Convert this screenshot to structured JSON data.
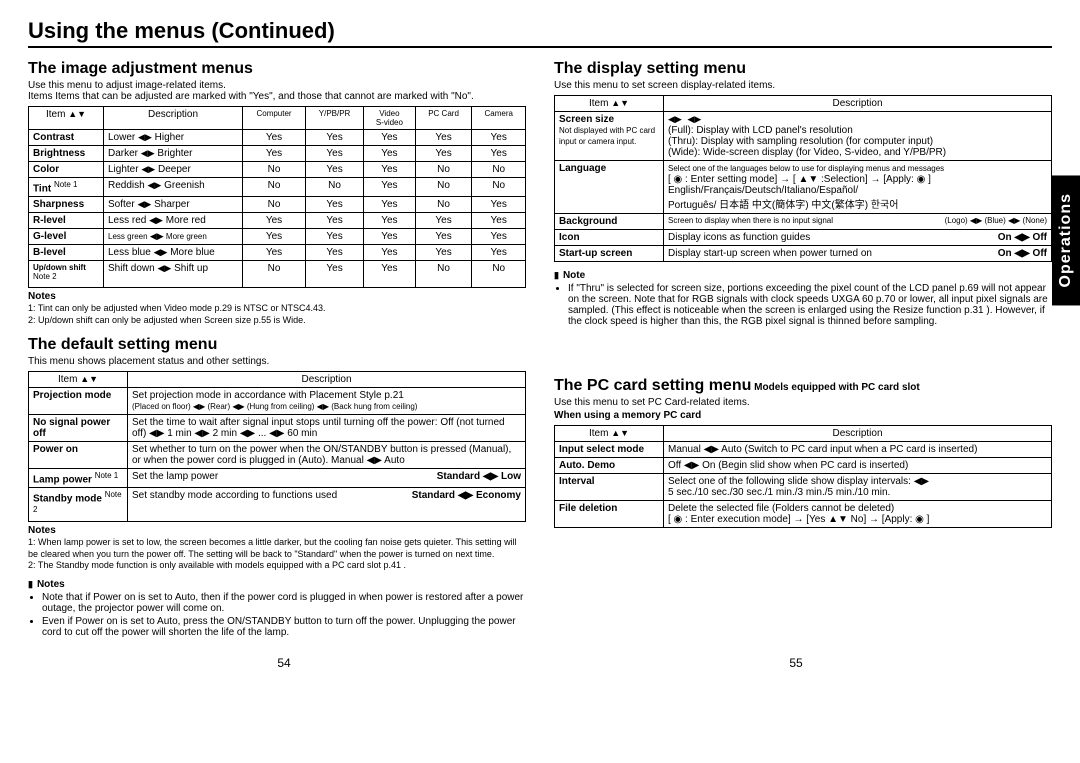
{
  "title": "Using the menus (Continued)",
  "left": {
    "h_image": "The image adjustment menus",
    "image_intro": "Use this menu to adjust image-related items.\nItems Items that can be adjusted are marked with \"Yes\", and those that cannot are marked with \"No\".",
    "image_headers": [
      "Item",
      "Description",
      "Computer",
      "Y/PB/PR",
      "Video\nS-video",
      "PC Card",
      "Camera"
    ],
    "image_rows": [
      {
        "item": "Contrast",
        "lo": "Lower",
        "hi": "Higher",
        "v": [
          "Yes",
          "Yes",
          "Yes",
          "Yes",
          "Yes"
        ]
      },
      {
        "item": "Brightness",
        "lo": "Darker",
        "hi": "Brighter",
        "v": [
          "Yes",
          "Yes",
          "Yes",
          "Yes",
          "Yes"
        ]
      },
      {
        "item": "Color",
        "lo": "Lighter",
        "hi": "Deeper",
        "v": [
          "No",
          "Yes",
          "Yes",
          "No",
          "No"
        ]
      },
      {
        "item": "Tint",
        "note": "Note 1",
        "lo": "Reddish",
        "hi": "Greenish",
        "v": [
          "No",
          "No",
          "Yes",
          "No",
          "No"
        ]
      },
      {
        "item": "Sharpness",
        "lo": "Softer",
        "hi": "Sharper",
        "v": [
          "No",
          "Yes",
          "Yes",
          "No",
          "Yes"
        ]
      },
      {
        "item": "R-level",
        "lo": "Less red",
        "hi": "More red",
        "v": [
          "Yes",
          "Yes",
          "Yes",
          "Yes",
          "Yes"
        ]
      },
      {
        "item": "G-level",
        "lo": "Less green",
        "hi": "More green",
        "v": [
          "Yes",
          "Yes",
          "Yes",
          "Yes",
          "Yes"
        ]
      },
      {
        "item": "B-level",
        "lo": "Less blue",
        "hi": "More blue",
        "v": [
          "Yes",
          "Yes",
          "Yes",
          "Yes",
          "Yes"
        ]
      },
      {
        "item": "Up/down shift",
        "note": "Note 2",
        "lo": "Shift down",
        "hi": "Shift up",
        "v": [
          "No",
          "Yes",
          "Yes",
          "No",
          "No"
        ]
      }
    ],
    "image_notes_title": "Notes",
    "image_note1": "1: Tint can only be adjusted when Video mode p.29  is NTSC or NTSC4.43.",
    "image_note2": "2: Up/down shift can only be adjusted when Screen size p.55  is Wide.",
    "h_default": "The default setting menu",
    "default_intro": "This menu shows placement status and other settings.",
    "default_headers": [
      "Item",
      "Description"
    ],
    "d_proj_item": "Projection mode",
    "d_proj_desc": "Set projection mode in accordance with Placement Style p.21",
    "d_proj_opts": "(Placed on floor) ◀▶  (Rear) ◀▶  (Hung from ceiling) ◀▶  (Back hung from ceiling)",
    "d_nosig_item": "No signal power off",
    "d_nosig_desc": "Set the time to wait after signal input stops until turning off the power: Off (not turned off) ◀▶ 1 min ◀▶ 2 min ◀▶ ... ◀▶ 60 min",
    "d_power_item": "Power on",
    "d_power_desc": "Set whether to turn on the power when the ON/STANDBY button is pressed (Manual), or when the power cord is plugged in (Auto).  Manual ◀▶ Auto",
    "d_lamp_item": "Lamp power",
    "d_lamp_note": "Note 1",
    "d_lamp_desc": "Set the lamp power",
    "d_lamp_right": "Standard ◀▶ Low",
    "d_standby_item": "Standby mode",
    "d_standby_note": "Note 2",
    "d_standby_desc": "Set standby mode according to functions used",
    "d_standby_right": "Standard ◀▶ Economy",
    "default_notes_title": "Notes",
    "default_note1": "1: When lamp power is set to low, the screen becomes a little darker, but the cooling fan noise gets quieter. This setting will be cleared when you turn the power off. The setting will be back to \"Standard\" when the power is turned on next time.",
    "default_note2": "2: The Standby mode function is only available with models equipped with a PC card slot p.41 .",
    "h_notes": "Notes",
    "gen_note1": "Note that if Power on is set to Auto, then if the power cord is plugged in when power is restored after a power outage, the projector power will come on.",
    "gen_note2": "Even if Power on is set to Auto, press the ON/STANDBY button to turn off the power. Unplugging the power cord to cut off the power will shorten the life of the lamp.",
    "page": "54"
  },
  "right": {
    "h_display": "The display setting menu",
    "display_intro": "Use this menu to set screen display-related items.",
    "display_headers": [
      "Item",
      "Description"
    ],
    "screen_item": "Screen size",
    "screen_subnote": "Not displayed with PC card input or camera input.",
    "screen_desc_full": "(Full): Display with LCD panel's resolution",
    "screen_desc_thru": "(Thru): Display with sampling resolution (for computer input)",
    "screen_desc_wide": "(Wide): Wide-screen display (for Video, S-video, and Y/PB/PR)",
    "lang_item": "Language",
    "lang_desc1": "Select one of the languages below to use for displaying menus and messages",
    "lang_desc2": "[ ◉ : Enter setting mode] → [ ▲▼ :Selection] → [Apply: ◉ ]",
    "lang_list": "English/Français/Deutsch/Italiano/Español/\nPortuguês/ 日本語 中文(簡体字) 中文(繁体字) 한국어",
    "bg_item": "Background",
    "bg_desc": "Screen to display when there is no input signal",
    "bg_opts": "(Logo) ◀▶   (Blue) ◀▶   (None)",
    "icon_item": "Icon",
    "icon_desc": "Display icons as function guides",
    "icon_opts": "On ◀▶ Off",
    "start_item": "Start-up screen",
    "start_desc": "Display start-up screen when power turned on",
    "start_opts": "On ◀▶ Off",
    "h_note": "Note",
    "display_note": "If \"Thru\" is selected for screen size, portions exceeding the pixel count of the LCD panel p.69  will not appear on the screen. Note that for RGB signals with clock speeds UXGA 60 p.70  or lower, all input pixel signals are sampled. (This effect is noticeable when the screen is enlarged using the Resize function p.31 ). However, if the clock speed is higher than this, the RGB pixel signal is thinned before sampling.",
    "h_pc": "The PC card setting menu",
    "pc_sub": " Models equipped with PC card slot",
    "pc_intro": "Use this menu to set PC Card-related items.",
    "pc_when": "When using a memory PC card",
    "pc_headers": [
      "Item",
      "Description"
    ],
    "pc_input_item": "Input select mode",
    "pc_input_desc": "Manual ◀▶ Auto (Switch to PC card input when a PC card is inserted)",
    "pc_auto_item": "Auto. Demo",
    "pc_auto_desc": "Off ◀▶ On (Begin slid show when PC card is inserted)",
    "pc_int_item": "Interval",
    "pc_int_desc": "Select one of the following slide show display intervals: ◀▶\n5 sec./10 sec./30 sec./1 min./3 min./5 min./10 min.",
    "pc_del_item": "File deletion",
    "pc_del_desc": "Delete the selected file (Folders cannot be deleted)\n[ ◉ : Enter execution mode] → [Yes ▲▼ No] → [Apply: ◉ ]",
    "page": "55"
  },
  "sidetab": "Operations"
}
